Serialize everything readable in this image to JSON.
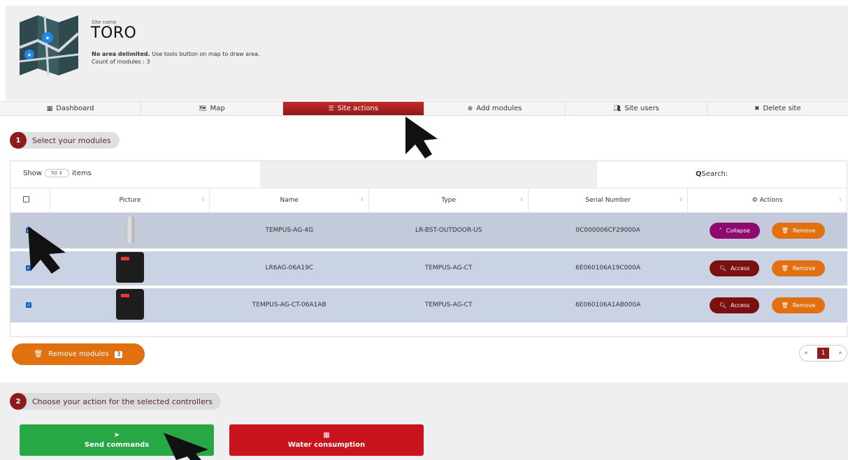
{
  "header": {
    "site_label": "Site name",
    "site_name": "TORO",
    "area_bold": "No area delimited.",
    "area_rest": " Use tools button on map to draw area.",
    "count_text": "Count of modules : 3"
  },
  "tabs": [
    {
      "label": "Dashboard",
      "icon": "grid-icon"
    },
    {
      "label": "Map",
      "icon": "map-icon"
    },
    {
      "label": "Site actions",
      "icon": "sliders-icon"
    },
    {
      "label": "Add modules",
      "icon": "plus-circle-icon"
    },
    {
      "label": "Site users",
      "icon": "users-icon"
    },
    {
      "label": "Delete site",
      "icon": "x-icon"
    }
  ],
  "step1": {
    "num": "1",
    "label": "Select your modules"
  },
  "step2": {
    "num": "2",
    "label": "Choose your action for the selected controllers"
  },
  "table": {
    "show_label": "Show",
    "show_value": "50",
    "items_label": "items",
    "search_label": "Search:",
    "columns": [
      "Picture",
      "Name",
      "Type",
      "Serial Number",
      "Actions"
    ],
    "rows": [
      {
        "name": "TEMPUS-AG-4G",
        "type": "LR-BST-OUTDOOR-US",
        "serial": "0C000006CF29000A",
        "action1": "Collapse",
        "action2": "Remove"
      },
      {
        "name": "LR6AG-06A19C",
        "type": "TEMPUS-AG-CT",
        "serial": "6E060106A19C000A",
        "action1": "Access",
        "action2": "Remove"
      },
      {
        "name": "TEMPUS-AG-CT-06A1AB",
        "type": "TEMPUS-AG-CT",
        "serial": "6E060106A1AB000A",
        "action1": "Access",
        "action2": "Remove"
      }
    ]
  },
  "remove_modules": {
    "label": "Remove modules",
    "count": "3"
  },
  "pager": {
    "prev": "«",
    "current": "1",
    "next": "»"
  },
  "actions": {
    "send_commands": "Send commands",
    "water_consumption": "Water consumption"
  },
  "colors": {
    "primary": "#8e1b1b",
    "remove": "#e07010",
    "send": "#28a745",
    "water": "#c9141e",
    "collapse": "#8e0a6e"
  }
}
